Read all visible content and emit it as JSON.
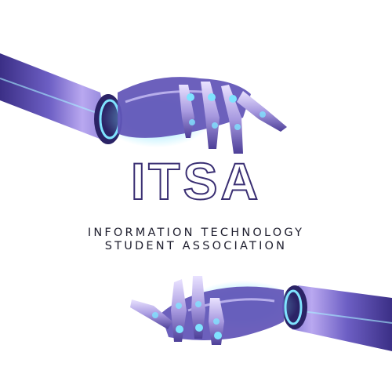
{
  "logo": {
    "title": "ITSA",
    "subtitle_line1": "INFORMATION TECHNOLOGY",
    "subtitle_line2": "STUDENT ASSOCIATION"
  },
  "colors": {
    "title_outline": "#3a2f73",
    "subtitle_text": "#1e1e2e",
    "robot_metal": "#4b3f8f",
    "robot_glow": "#7fe3ff",
    "background": "#ffffff"
  }
}
